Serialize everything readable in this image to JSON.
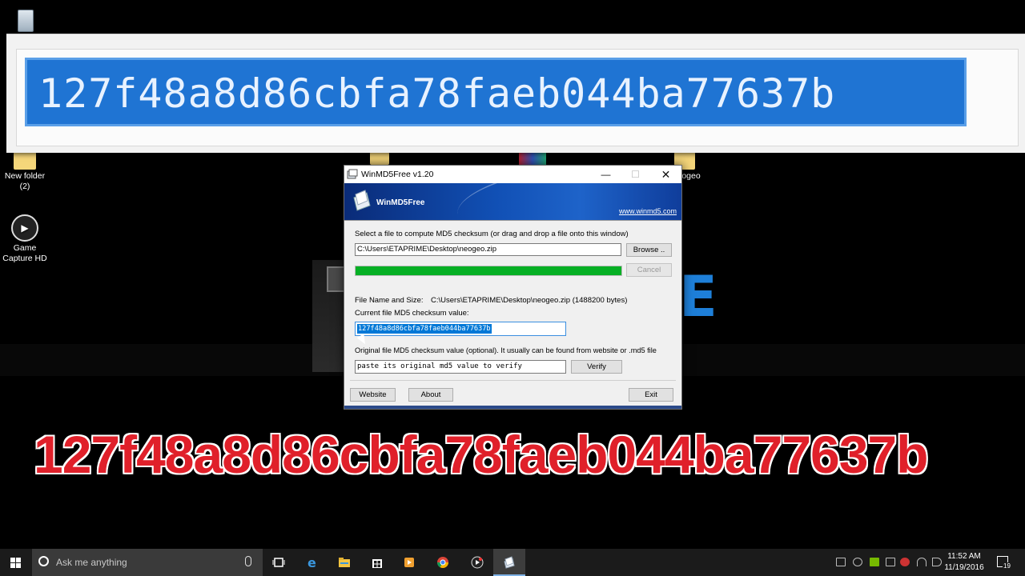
{
  "desktop": {
    "icons": {
      "recycle_bin": "",
      "new_folder": "New folder\n(2)",
      "game_capture": "Game Capture HD",
      "neogeo": "ogeo"
    },
    "background_letter": "E"
  },
  "zoom_overlay": {
    "text": "127f48a8d86cbfa78faeb044ba77637b"
  },
  "window": {
    "title": "WinMD5Free v1.20",
    "controls": {
      "minimize": "—",
      "maximize": "☐",
      "close": "✕"
    },
    "banner": {
      "app_name": "WinMD5Free",
      "website_link": "www.winmd5.com"
    },
    "select_label": "Select a file to compute MD5 checksum (or drag and drop a file onto this window)",
    "file_path": "C:\\Users\\ETAPRIME\\Desktop\\neogeo.zip",
    "browse_label": "Browse ..",
    "progress_fraction": 1.0,
    "cancel_label": "Cancel",
    "file_name_size_label": "File Name and Size:",
    "file_name_size_value": "C:\\Users\\ETAPRIME\\Desktop\\neogeo.zip (1488200 bytes)",
    "current_md5_label": "Current file MD5 checksum value:",
    "current_md5_value": "127f48a8d86cbfa78faeb044ba77637b",
    "original_md5_label": "Original file MD5 checksum value (optional). It usually can be found from website or .md5 file",
    "original_md5_placeholder": "paste its original md5 value to verify",
    "verify_label": "Verify",
    "website_label": "Website",
    "about_label": "About",
    "exit_label": "Exit"
  },
  "caption": {
    "md5_text": "127f48a8d86cbfa78faeb044ba77637b"
  },
  "taskbar": {
    "search_placeholder": "Ask me anything",
    "apps": [
      "task-view",
      "edge",
      "file-explorer",
      "store",
      "media-player",
      "chrome",
      "game-capture",
      "winmd5free"
    ],
    "clock_time": "11:52 AM",
    "clock_date": "11/19/2016",
    "notification_count": "19"
  },
  "colors": {
    "banner_blue": "#1150b5",
    "progress_green": "#06b025",
    "selection_blue": "#0078d7",
    "caption_red": "#e0202a",
    "taskbar": "#1b1b1b"
  }
}
